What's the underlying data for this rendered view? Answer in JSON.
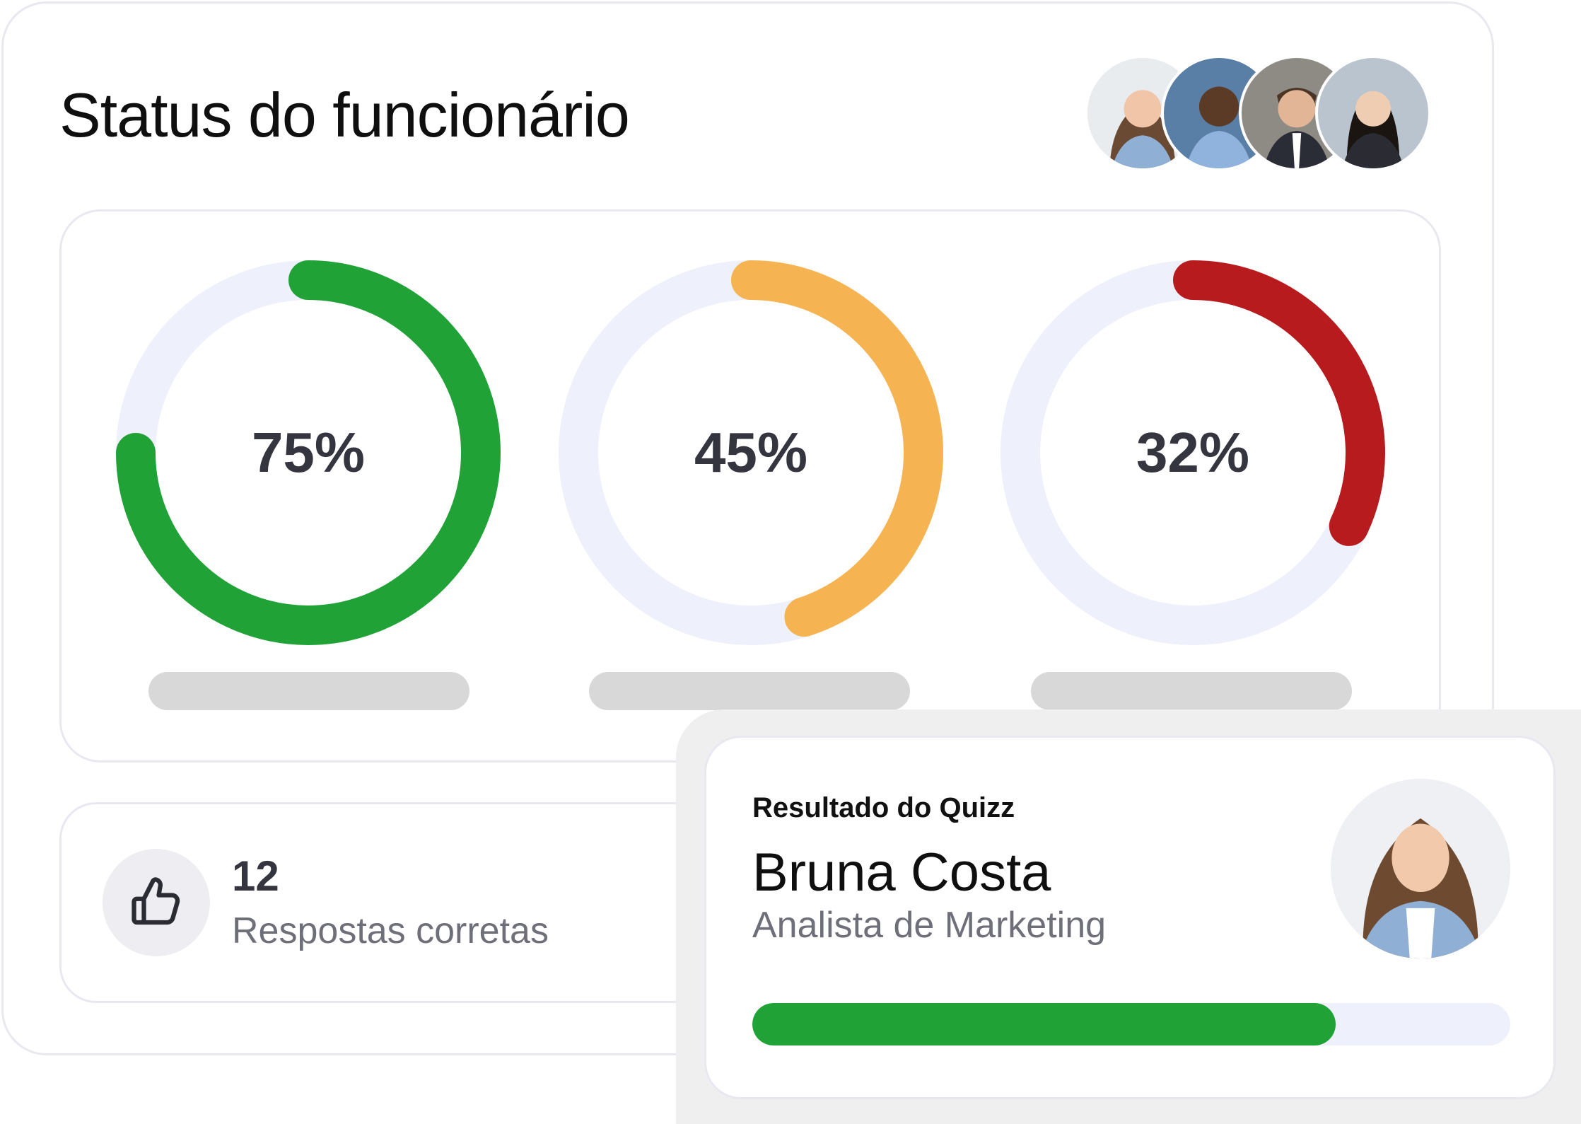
{
  "header": {
    "title": "Status do funcionário"
  },
  "team_avatars": [
    {
      "name": "avatar-woman-1"
    },
    {
      "name": "avatar-man-1"
    },
    {
      "name": "avatar-man-2"
    },
    {
      "name": "avatar-woman-2"
    }
  ],
  "gauges": [
    {
      "value_label": "75%",
      "value": 0.75,
      "color": "#20a236",
      "start": 0.0
    },
    {
      "value_label": "45%",
      "value": 0.45,
      "color": "#f6b351",
      "start": 0.0
    },
    {
      "value_label": "32%",
      "value": 0.32,
      "color": "#b81b1d",
      "start": 0.0
    }
  ],
  "gauge_track_color": "#eef0fb",
  "answers": {
    "icon": "thumbs-up-icon",
    "count": "12",
    "label": "Respostas corretas"
  },
  "quiz": {
    "heading": "Resultado do Quizz",
    "person_name": "Bruna Costa",
    "person_role": "Analista de Marketing",
    "progress": 0.77,
    "progress_color": "#20a236"
  }
}
